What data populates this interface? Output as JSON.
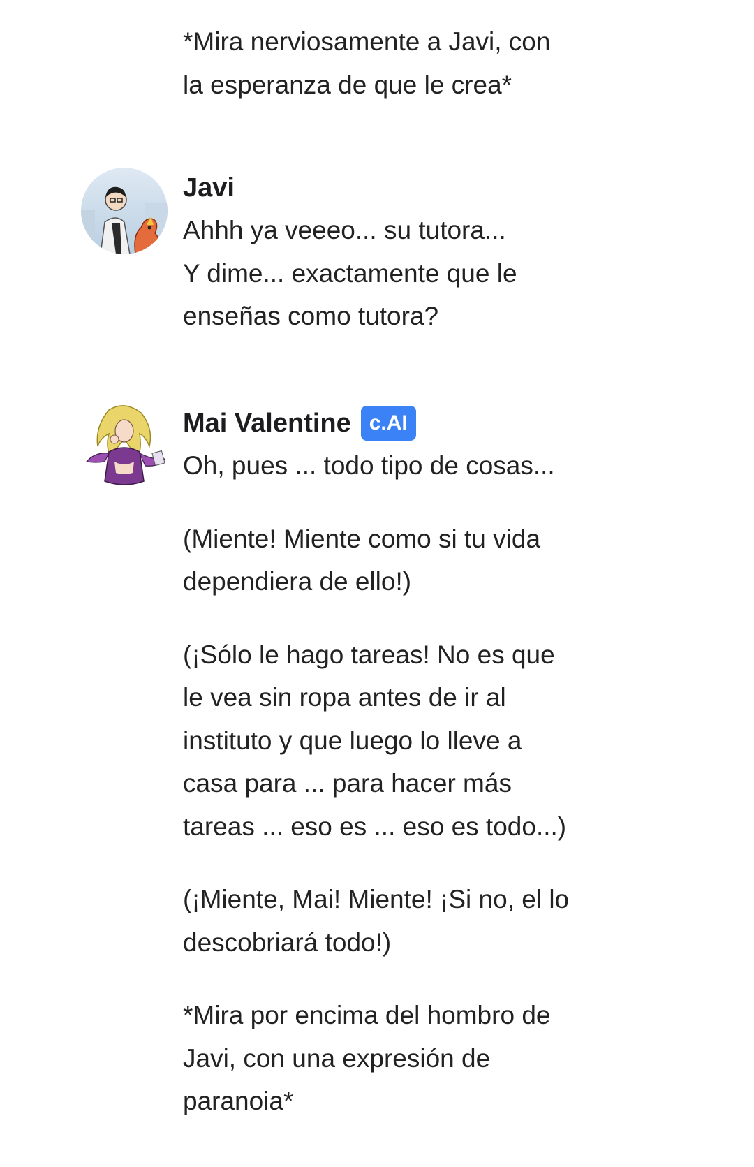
{
  "messages": [
    {
      "sender": "",
      "paragraphs": [
        "*Mira nerviosamente a Javi, con\nla esperanza de que le crea*"
      ]
    },
    {
      "sender": "Javi",
      "avatar_icon": "user-avatar-javi-icon",
      "paragraphs": [
        "Ahhh ya veeeo... su tutora...\nY dime... exactamente que le\nenseñas como tutora?"
      ]
    },
    {
      "sender": "Mai Valentine",
      "badge": "c.AI",
      "avatar_icon": "character-avatar-mai-icon",
      "paragraphs": [
        "Oh, pues ... todo tipo de cosas...",
        "(Miente! Miente como si tu vida\ndependiera de ello!)",
        "(¡Sólo le hago tareas! No es que\nle vea sin ropa antes de ir al\ninstituto y que luego lo lleve a\ncasa para ... para hacer más\ntareas ... eso es ... eso es todo...)",
        "(¡Miente, Mai! Miente! ¡Si no, el lo\ndescobriará todo!)",
        "*Mira por encima del hombro de\nJavi, con una expresión de\nparanoia*"
      ]
    }
  ],
  "colors": {
    "background": "#ffffff",
    "text": "#222222",
    "badge_bg": "#3b82f6",
    "badge_text": "#ffffff"
  }
}
